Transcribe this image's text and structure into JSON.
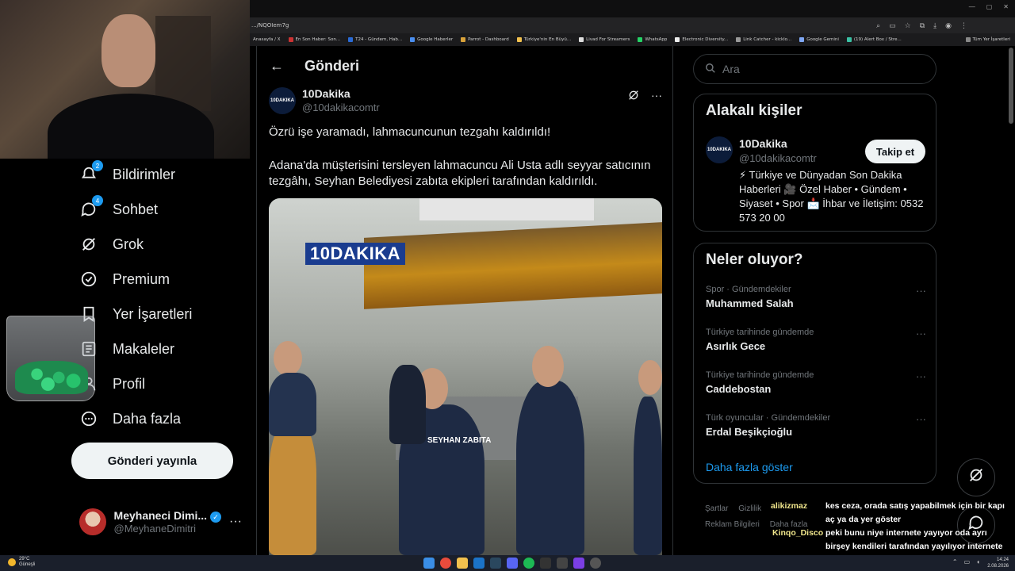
{
  "browser": {
    "url": ".../NQOIem7g",
    "bookmarks": [
      "Anasayfa / X",
      "En Son Haber: Son...",
      "T24 - Gündem, Hab...",
      "Google Haberler",
      "Parrot - Dashboard",
      "Türkiye'nin En Büyü...",
      "Livad For Streamers",
      "WhatsApp",
      "Electronic Diversity...",
      "Link Catcher - kicklo...",
      "Google Gemini",
      "(19) Alert Box / Stre..."
    ],
    "all_bookmarks": "Tüm Yer İşaretleri"
  },
  "sidebar": {
    "items": [
      {
        "label": "Bildirimler",
        "badge": "2",
        "icon": "bell-icon"
      },
      {
        "label": "Sohbet",
        "badge": "4",
        "icon": "chat-bubble-icon"
      },
      {
        "label": "Grok",
        "icon": "grok-icon"
      },
      {
        "label": "Premium",
        "icon": "verified-badge-icon"
      },
      {
        "label": "Yer İşaretleri",
        "icon": "bookmark-icon"
      },
      {
        "label": "Makaleler",
        "icon": "article-icon"
      },
      {
        "label": "Profil",
        "icon": "user-icon"
      },
      {
        "label": "Daha fazla",
        "icon": "more-circle-icon"
      }
    ],
    "post_button": "Gönderi yayınla",
    "account": {
      "name": "Meyhaneci Dimi...",
      "handle": "@MeyhaneDimitri",
      "more": "···"
    }
  },
  "main": {
    "title": "Gönderi",
    "tweet": {
      "name": "10Dakika",
      "handle": "@10dakikacomtr",
      "avatar_text": "10DAKIKA",
      "more": "···",
      "text1": "Özrü işe yaramadı, lahmacuncunun tezgahı kaldırıldı!",
      "text2": "Adana'da müşterisini tersleyen lahmacuncu Ali Usta adlı seyyar satıcının tezgâhı, Seyhan Belediyesi zabıta ekipleri tarafından kaldırıldı.",
      "media_logo": "10DAKIKA",
      "media_vest": "SEYHAN ZABITA"
    }
  },
  "right": {
    "search_placeholder": "Ara",
    "people": {
      "title": "Alakalı kişiler",
      "name": "10Dakika",
      "handle": "@10dakikacomtr",
      "avatar_text": "10DAKIKA",
      "follow": "Takip et",
      "bio": "⚡ Türkiye ve Dünyadan Son Dakika Haberleri 🎥 Özel Haber • Gündem • Siyaset • Spor 📩 İhbar ve İletişim: 0532 573 20 00"
    },
    "trends": {
      "title": "Neler oluyor?",
      "items": [
        {
          "meta": "Spor · Gündemdekiler",
          "name": "Muhammed Salah"
        },
        {
          "meta": "Türkiye tarihinde gündemde",
          "name": "Asırlık Gece"
        },
        {
          "meta": "Türkiye tarihinde gündemde",
          "name": "Caddebostan"
        },
        {
          "meta": "Türk oyuncular · Gündemdekiler",
          "name": "Erdal Beşikçioğlu"
        }
      ],
      "more_dots": "···",
      "show_more": "Daha fazla göster"
    },
    "footer": [
      "Şartlar",
      "Gizlilik",
      "Reklam Bilgileri",
      "Daha fazla"
    ]
  },
  "chat": [
    {
      "user": "alikizmaz",
      "msg": "kes ceza, orada satış yapabilmek için bir kapı aç ya da yer göster",
      "color": "#f0e68c"
    },
    {
      "user": "Kinqo_Disco",
      "msg": "peki bunu niye internete yayıyor oda ayrı birşey kendileri tarafından yayılıyor internete oda ayrı bişey",
      "color": "#f0e68c"
    }
  ],
  "taskbar": {
    "temp": "29°C",
    "weather": "Güneşli",
    "time": "14:24",
    "date": "2.08.2026"
  },
  "colors": {
    "accent": "#1d9bf0",
    "background": "#000000",
    "border": "#2f3336",
    "muted": "#71767b"
  }
}
